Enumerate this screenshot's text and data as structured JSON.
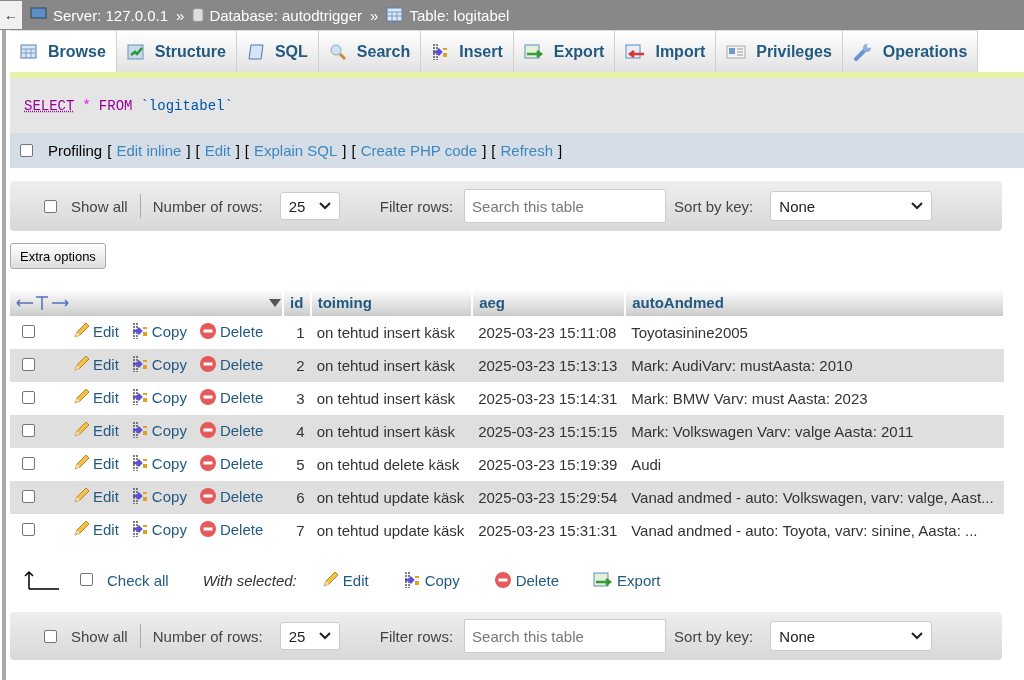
{
  "breadcrumb": {
    "back": "←",
    "separators": [
      "»",
      "»"
    ],
    "items": [
      {
        "kind": "server",
        "label": "Server: 127.0.0.1"
      },
      {
        "kind": "database",
        "label": "Database: autodtrigger"
      },
      {
        "kind": "table",
        "label": "Table: logitabel"
      }
    ]
  },
  "tabs": [
    {
      "kind": "browse",
      "label": "Browse",
      "selected": true
    },
    {
      "kind": "structure",
      "label": "Structure",
      "selected": false
    },
    {
      "kind": "sql",
      "label": "SQL",
      "selected": false
    },
    {
      "kind": "search",
      "label": "Search",
      "selected": false
    },
    {
      "kind": "insert",
      "label": "Insert",
      "selected": false
    },
    {
      "kind": "export",
      "label": "Export",
      "selected": false
    },
    {
      "kind": "import",
      "label": "Import",
      "selected": false
    },
    {
      "kind": "privileges",
      "label": "Privileges",
      "selected": false
    },
    {
      "kind": "operations",
      "label": "Operations",
      "selected": false
    }
  ],
  "query": [
    {
      "kind": "keyword",
      "text": "SELECT"
    },
    {
      "kind": "operator",
      "text": "*"
    },
    {
      "kind": "keyword",
      "text": "FROM"
    },
    {
      "kind": "identifier",
      "text": "`logitabel`"
    }
  ],
  "profiling": {
    "checked": false,
    "label": "Profiling",
    "brackets": [
      "[",
      "]"
    ],
    "links": [
      "Edit inline",
      "Edit",
      "Explain SQL",
      "Create PHP code",
      "Refresh"
    ]
  },
  "navigation": [
    {
      "show_all": {
        "label": "Show all",
        "checked": false
      },
      "rows_label": "Number of rows:",
      "rows_value": "25",
      "filter_label": "Filter rows:",
      "filter_placeholder": "Search this table",
      "sort_label": "Sort by key:",
      "sort_value": "None"
    },
    {
      "show_all": {
        "label": "Show all",
        "checked": false
      },
      "rows_label": "Number of rows:",
      "rows_value": "25",
      "filter_label": "Filter rows:",
      "filter_placeholder": "Search this table",
      "sort_label": "Sort by key:",
      "sort_value": "None"
    }
  ],
  "extra_options": "Extra options",
  "table": {
    "columns": [
      "id",
      "toiming",
      "aeg",
      "autoAndmed"
    ],
    "rows": [
      {
        "checked": false,
        "actions": [
          "Edit",
          "Copy",
          "Delete"
        ],
        "cells": [
          "1",
          "on tehtud insert käsk",
          "2025-03-23 15:11:08",
          "Toyotasinine2005"
        ]
      },
      {
        "checked": false,
        "actions": [
          "Edit",
          "Copy",
          "Delete"
        ],
        "cells": [
          "2",
          "on tehtud insert käsk",
          "2025-03-23 15:13:13",
          "Mark: AudiVarv: mustAasta: 2010"
        ]
      },
      {
        "checked": false,
        "actions": [
          "Edit",
          "Copy",
          "Delete"
        ],
        "cells": [
          "3",
          "on tehtud insert käsk",
          "2025-03-23 15:14:31",
          "Mark: BMW Varv: must Aasta: 2023"
        ]
      },
      {
        "checked": false,
        "actions": [
          "Edit",
          "Copy",
          "Delete"
        ],
        "cells": [
          "4",
          "on tehtud insert käsk",
          "2025-03-23 15:15:15",
          "Mark: Volkswagen Varv: valge Aasta: 2011"
        ]
      },
      {
        "checked": false,
        "actions": [
          "Edit",
          "Copy",
          "Delete"
        ],
        "cells": [
          "5",
          "on tehtud delete käsk",
          "2025-03-23 15:19:39",
          "Audi"
        ]
      },
      {
        "checked": false,
        "actions": [
          "Edit",
          "Copy",
          "Delete"
        ],
        "cells": [
          "6",
          "on tehtud update käsk",
          "2025-03-23 15:29:54",
          "Vanad andmed - auto: Volkswagen, varv: valge, Aast..."
        ]
      },
      {
        "checked": false,
        "actions": [
          "Edit",
          "Copy",
          "Delete"
        ],
        "cells": [
          "7",
          "on tehtud update käsk",
          "2025-03-23 15:31:31",
          "Vanad andmed - auto: Toyota, varv: sinine, Aasta: ..."
        ]
      }
    ]
  },
  "bulk": {
    "check_all": {
      "label": "Check all",
      "checked": false
    },
    "with_selected": "With selected:",
    "actions": [
      {
        "kind": "edit",
        "label": "Edit"
      },
      {
        "kind": "copy",
        "label": "Copy"
      },
      {
        "kind": "delete",
        "label": "Delete"
      },
      {
        "kind": "export",
        "label": "Export"
      }
    ]
  }
}
